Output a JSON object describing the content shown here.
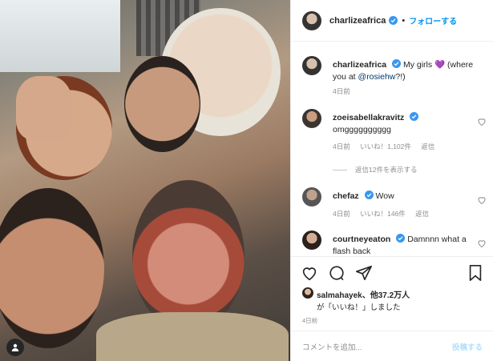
{
  "header": {
    "username": "charlizeafrica",
    "separator": "•",
    "follow_label": "フォローする"
  },
  "caption": {
    "username": "charlizeafrica",
    "text_before": "My girls 💜 (where you at ",
    "mention": "@rosiehw",
    "text_after": "?!)",
    "time": "4日前"
  },
  "comments": [
    {
      "username": "zoeisabellakravitz",
      "text": "omgggggggggg",
      "time": "4日前",
      "likes": "いいね！1,102件",
      "reply": "返信"
    },
    {
      "username": "chefaz",
      "text": "Wow",
      "time": "4日前",
      "likes": "いいね！146件",
      "reply": "返信"
    },
    {
      "username": "courtneyeaton",
      "text": "Damnnn what a flash back"
    }
  ],
  "view_replies": "返信12件を表示する",
  "likes": {
    "first_user": "salmahayek",
    "others": "、他37.2万人",
    "suffix": "が「いいね！」しました"
  },
  "post_date": "4日前",
  "compose": {
    "placeholder": "コメントを追加...",
    "post_label": "投稿する"
  },
  "colors": {
    "accent": "#0095f6",
    "verified": "#3897f0",
    "muted": "#8e8e8e",
    "post_disabled": "#b2dffc"
  },
  "icons": [
    "verified-badge-icon",
    "heart-icon",
    "comment-icon",
    "share-icon",
    "bookmark-icon",
    "user-tag-icon"
  ]
}
